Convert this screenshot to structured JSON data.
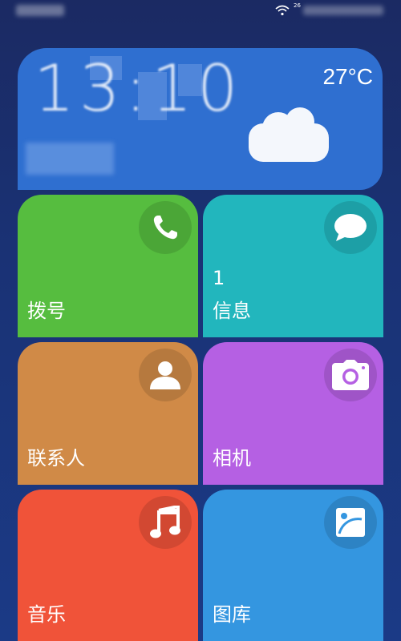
{
  "status_bar": {
    "signal_text": "26"
  },
  "weather": {
    "clock": "13:10",
    "temperature": "27°C",
    "condition_icon": "cloud-icon"
  },
  "tiles": [
    {
      "label": "拨号",
      "icon": "phone-icon",
      "color": "#56bd3f"
    },
    {
      "label": "信息",
      "icon": "message-icon",
      "count": "1",
      "color": "#22b6bd"
    },
    {
      "label": "联系人",
      "icon": "contact-icon",
      "color": "#d08a47"
    },
    {
      "label": "相机",
      "icon": "camera-icon",
      "color": "#b560e3"
    },
    {
      "label": "音乐",
      "icon": "music-note-icon",
      "color": "#f05339"
    },
    {
      "label": "图库",
      "icon": "gallery-icon",
      "color": "#3496e0"
    }
  ]
}
